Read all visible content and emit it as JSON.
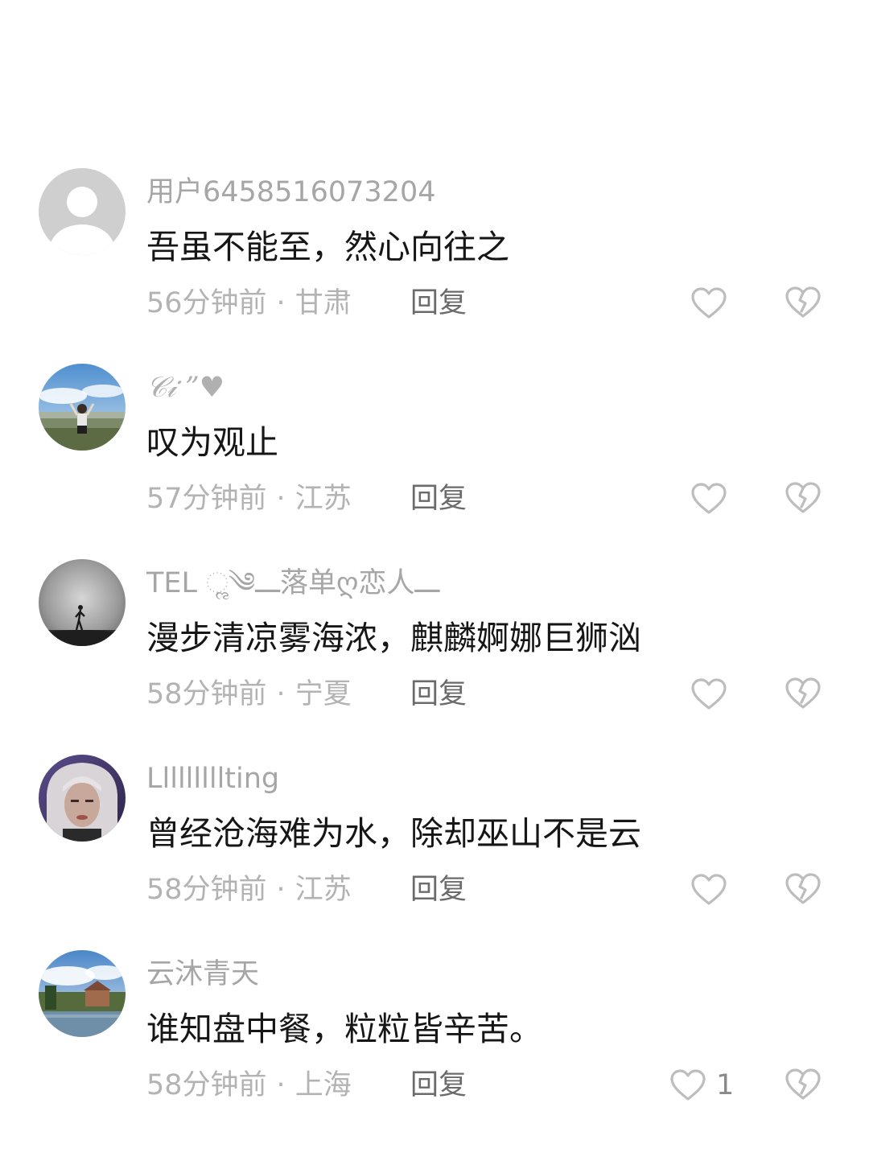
{
  "comments": [
    {
      "username": "用户6458516073204",
      "text": "吾虽不能至，然心向往之",
      "time": "56分钟前",
      "location": "甘肃",
      "reply_label": "回复",
      "likes": ""
    },
    {
      "username": "𝒞𝒾 ”♥",
      "text": "叹为观止",
      "time": "57分钟前",
      "location": "江苏",
      "reply_label": "回复",
      "likes": ""
    },
    {
      "username": "TEL ૢ༄ـــ落单ღ恋人ـــ",
      "text": "漫步清凉雾海浓，麒麟婀娜巨狮汹",
      "time": "58分钟前",
      "location": "宁夏",
      "reply_label": "回复",
      "likes": ""
    },
    {
      "username": "Lllllllllting",
      "text": "曾经沧海难为水，除却巫山不是云",
      "time": "58分钟前",
      "location": "江苏",
      "reply_label": "回复",
      "likes": ""
    },
    {
      "username": "云沐青天",
      "text": "谁知盘中餐，粒粒皆辛苦。",
      "time": "58分钟前",
      "location": "上海",
      "reply_label": "回复",
      "likes": "1"
    }
  ],
  "separator": "·",
  "colors": {
    "username": "#a6a6a6",
    "content": "#161616",
    "meta": "#b3b3b3",
    "reply": "#6b6b6b",
    "icon": "#bdbdbd"
  }
}
